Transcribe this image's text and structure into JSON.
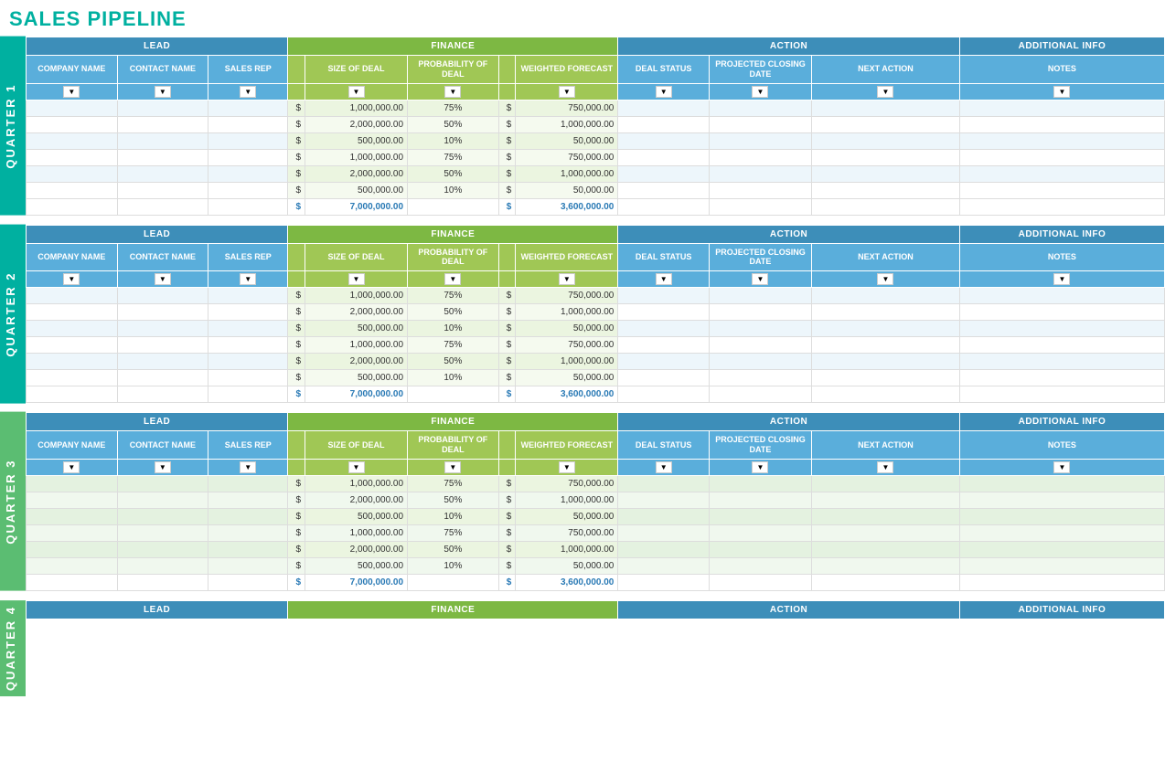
{
  "title": "SALES PIPELINE",
  "sections": {
    "lead_header": "LEAD",
    "finance_header": "FINANCE",
    "action_header": "ACTION",
    "addinfo_header": "ADDITIONAL INFO"
  },
  "columns": {
    "company_name": "COMPANY NAME",
    "contact_name": "CONTACT NAME",
    "sales_rep": "SALES REP",
    "size_of_deal": "SIZE OF DEAL",
    "probability_of_deal": "PROBABILITY OF DEAL",
    "weighted_forecast": "WEIGHTED FORECAST",
    "deal_status": "DEAL STATUS",
    "projected_closing_date": "PROJECTED CLOSING DATE",
    "next_action": "NEXT ACTION",
    "notes": "NOTES"
  },
  "quarters": [
    {
      "label": "QUARTER 1",
      "rows": [
        {
          "size": "1,000,000.00",
          "prob": "75%",
          "wf": "750,000.00"
        },
        {
          "size": "2,000,000.00",
          "prob": "50%",
          "wf": "1,000,000.00"
        },
        {
          "size": "500,000.00",
          "prob": "10%",
          "wf": "50,000.00"
        },
        {
          "size": "1,000,000.00",
          "prob": "75%",
          "wf": "750,000.00"
        },
        {
          "size": "2,000,000.00",
          "prob": "50%",
          "wf": "1,000,000.00"
        },
        {
          "size": "500,000.00",
          "prob": "10%",
          "wf": "50,000.00"
        }
      ],
      "total_size": "7,000,000.00",
      "total_wf": "3,600,000.00"
    },
    {
      "label": "QUARTER 2",
      "rows": [
        {
          "size": "1,000,000.00",
          "prob": "75%",
          "wf": "750,000.00"
        },
        {
          "size": "2,000,000.00",
          "prob": "50%",
          "wf": "1,000,000.00"
        },
        {
          "size": "500,000.00",
          "prob": "10%",
          "wf": "50,000.00"
        },
        {
          "size": "1,000,000.00",
          "prob": "75%",
          "wf": "750,000.00"
        },
        {
          "size": "2,000,000.00",
          "prob": "50%",
          "wf": "1,000,000.00"
        },
        {
          "size": "500,000.00",
          "prob": "10%",
          "wf": "50,000.00"
        }
      ],
      "total_size": "7,000,000.00",
      "total_wf": "3,600,000.00"
    },
    {
      "label": "QUARTER 3",
      "rows": [
        {
          "size": "1,000,000.00",
          "prob": "75%",
          "wf": "750,000.00"
        },
        {
          "size": "2,000,000.00",
          "prob": "50%",
          "wf": "1,000,000.00"
        },
        {
          "size": "500,000.00",
          "prob": "10%",
          "wf": "50,000.00"
        },
        {
          "size": "1,000,000.00",
          "prob": "75%",
          "wf": "750,000.00"
        },
        {
          "size": "2,000,000.00",
          "prob": "50%",
          "wf": "1,000,000.00"
        },
        {
          "size": "500,000.00",
          "prob": "10%",
          "wf": "50,000.00"
        }
      ],
      "total_size": "7,000,000.00",
      "total_wf": "3,600,000.00"
    }
  ],
  "bottom_partial": {
    "label": "QUARTER 4"
  }
}
